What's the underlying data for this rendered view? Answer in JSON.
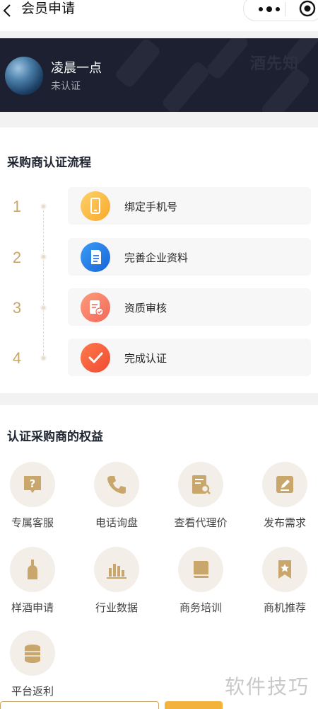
{
  "nav": {
    "title": "会员申请",
    "back_icon": "chevron-left-icon",
    "more_icon": "more-dots-icon",
    "close_icon": "target-circle-icon"
  },
  "profile": {
    "name": "凌晨一点",
    "status": "未认证",
    "brand_watermark": "酒先知"
  },
  "process": {
    "title": "采购商认证流程",
    "steps": [
      {
        "num": "1",
        "label": "绑定手机号",
        "icon": "phone-icon",
        "color": "#f7a92c"
      },
      {
        "num": "2",
        "label": "完善企业资料",
        "icon": "document-icon",
        "color": "#1665d8"
      },
      {
        "num": "3",
        "label": "资质审核",
        "icon": "audit-icon",
        "color": "#f06a5a"
      },
      {
        "num": "4",
        "label": "完成认证",
        "icon": "checkmark-icon",
        "color": "#ef4b33"
      }
    ]
  },
  "benefits": {
    "title": "认证采购商的权益",
    "items": [
      {
        "label": "专属客服",
        "icon": "question-bubble-icon"
      },
      {
        "label": "电话询盘",
        "icon": "phone-handset-icon"
      },
      {
        "label": "查看代理价",
        "icon": "price-search-icon"
      },
      {
        "label": "发布需求",
        "icon": "edit-icon"
      },
      {
        "label": "样酒申请",
        "icon": "bottle-icon"
      },
      {
        "label": "行业数据",
        "icon": "bar-chart-icon"
      },
      {
        "label": "商务培训",
        "icon": "book-icon"
      },
      {
        "label": "商机推荐",
        "icon": "bookmark-star-icon"
      },
      {
        "label": "平台返利",
        "icon": "coin-stack-icon"
      }
    ]
  },
  "overlay": {
    "site_watermark": "软件技巧"
  },
  "colors": {
    "accent": "#c9a66b",
    "banner_bg": "#1d2030",
    "icon_gold": "#c9a66b"
  }
}
